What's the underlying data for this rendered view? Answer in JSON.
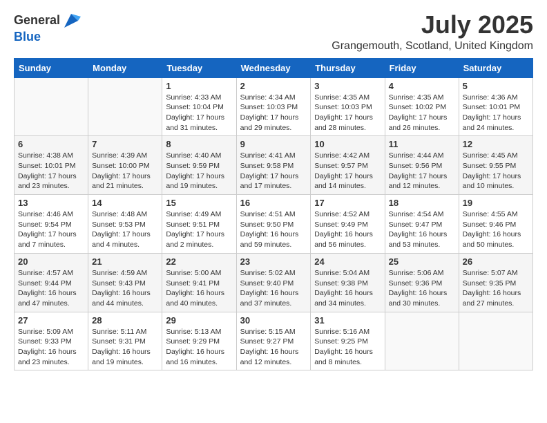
{
  "header": {
    "logo_general": "General",
    "logo_blue": "Blue",
    "month": "July 2025",
    "location": "Grangemouth, Scotland, United Kingdom"
  },
  "days_of_week": [
    "Sunday",
    "Monday",
    "Tuesday",
    "Wednesday",
    "Thursday",
    "Friday",
    "Saturday"
  ],
  "weeks": [
    [
      {
        "day": "",
        "info": ""
      },
      {
        "day": "",
        "info": ""
      },
      {
        "day": "1",
        "info": "Sunrise: 4:33 AM\nSunset: 10:04 PM\nDaylight: 17 hours and 31 minutes."
      },
      {
        "day": "2",
        "info": "Sunrise: 4:34 AM\nSunset: 10:03 PM\nDaylight: 17 hours and 29 minutes."
      },
      {
        "day": "3",
        "info": "Sunrise: 4:35 AM\nSunset: 10:03 PM\nDaylight: 17 hours and 28 minutes."
      },
      {
        "day": "4",
        "info": "Sunrise: 4:35 AM\nSunset: 10:02 PM\nDaylight: 17 hours and 26 minutes."
      },
      {
        "day": "5",
        "info": "Sunrise: 4:36 AM\nSunset: 10:01 PM\nDaylight: 17 hours and 24 minutes."
      }
    ],
    [
      {
        "day": "6",
        "info": "Sunrise: 4:38 AM\nSunset: 10:01 PM\nDaylight: 17 hours and 23 minutes."
      },
      {
        "day": "7",
        "info": "Sunrise: 4:39 AM\nSunset: 10:00 PM\nDaylight: 17 hours and 21 minutes."
      },
      {
        "day": "8",
        "info": "Sunrise: 4:40 AM\nSunset: 9:59 PM\nDaylight: 17 hours and 19 minutes."
      },
      {
        "day": "9",
        "info": "Sunrise: 4:41 AM\nSunset: 9:58 PM\nDaylight: 17 hours and 17 minutes."
      },
      {
        "day": "10",
        "info": "Sunrise: 4:42 AM\nSunset: 9:57 PM\nDaylight: 17 hours and 14 minutes."
      },
      {
        "day": "11",
        "info": "Sunrise: 4:44 AM\nSunset: 9:56 PM\nDaylight: 17 hours and 12 minutes."
      },
      {
        "day": "12",
        "info": "Sunrise: 4:45 AM\nSunset: 9:55 PM\nDaylight: 17 hours and 10 minutes."
      }
    ],
    [
      {
        "day": "13",
        "info": "Sunrise: 4:46 AM\nSunset: 9:54 PM\nDaylight: 17 hours and 7 minutes."
      },
      {
        "day": "14",
        "info": "Sunrise: 4:48 AM\nSunset: 9:53 PM\nDaylight: 17 hours and 4 minutes."
      },
      {
        "day": "15",
        "info": "Sunrise: 4:49 AM\nSunset: 9:51 PM\nDaylight: 17 hours and 2 minutes."
      },
      {
        "day": "16",
        "info": "Sunrise: 4:51 AM\nSunset: 9:50 PM\nDaylight: 16 hours and 59 minutes."
      },
      {
        "day": "17",
        "info": "Sunrise: 4:52 AM\nSunset: 9:49 PM\nDaylight: 16 hours and 56 minutes."
      },
      {
        "day": "18",
        "info": "Sunrise: 4:54 AM\nSunset: 9:47 PM\nDaylight: 16 hours and 53 minutes."
      },
      {
        "day": "19",
        "info": "Sunrise: 4:55 AM\nSunset: 9:46 PM\nDaylight: 16 hours and 50 minutes."
      }
    ],
    [
      {
        "day": "20",
        "info": "Sunrise: 4:57 AM\nSunset: 9:44 PM\nDaylight: 16 hours and 47 minutes."
      },
      {
        "day": "21",
        "info": "Sunrise: 4:59 AM\nSunset: 9:43 PM\nDaylight: 16 hours and 44 minutes."
      },
      {
        "day": "22",
        "info": "Sunrise: 5:00 AM\nSunset: 9:41 PM\nDaylight: 16 hours and 40 minutes."
      },
      {
        "day": "23",
        "info": "Sunrise: 5:02 AM\nSunset: 9:40 PM\nDaylight: 16 hours and 37 minutes."
      },
      {
        "day": "24",
        "info": "Sunrise: 5:04 AM\nSunset: 9:38 PM\nDaylight: 16 hours and 34 minutes."
      },
      {
        "day": "25",
        "info": "Sunrise: 5:06 AM\nSunset: 9:36 PM\nDaylight: 16 hours and 30 minutes."
      },
      {
        "day": "26",
        "info": "Sunrise: 5:07 AM\nSunset: 9:35 PM\nDaylight: 16 hours and 27 minutes."
      }
    ],
    [
      {
        "day": "27",
        "info": "Sunrise: 5:09 AM\nSunset: 9:33 PM\nDaylight: 16 hours and 23 minutes."
      },
      {
        "day": "28",
        "info": "Sunrise: 5:11 AM\nSunset: 9:31 PM\nDaylight: 16 hours and 19 minutes."
      },
      {
        "day": "29",
        "info": "Sunrise: 5:13 AM\nSunset: 9:29 PM\nDaylight: 16 hours and 16 minutes."
      },
      {
        "day": "30",
        "info": "Sunrise: 5:15 AM\nSunset: 9:27 PM\nDaylight: 16 hours and 12 minutes."
      },
      {
        "day": "31",
        "info": "Sunrise: 5:16 AM\nSunset: 9:25 PM\nDaylight: 16 hours and 8 minutes."
      },
      {
        "day": "",
        "info": ""
      },
      {
        "day": "",
        "info": ""
      }
    ]
  ]
}
